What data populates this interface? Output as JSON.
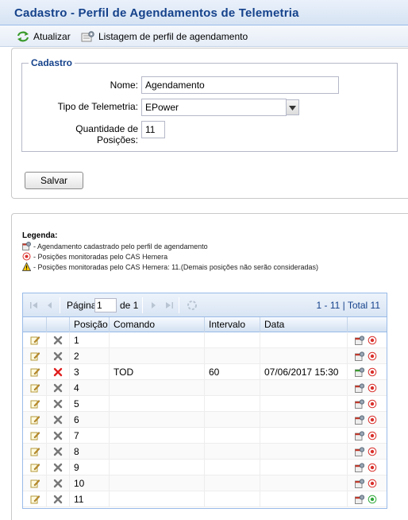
{
  "title": "Cadastro - Perfil de Agendamentos de Telemetria",
  "toolbar": {
    "refresh_label": "Atualizar",
    "list_label": "Listagem de perfil de agendamento"
  },
  "form": {
    "legend": "Cadastro",
    "name_label": "Nome:",
    "name_value": "Agendamento",
    "type_label": "Tipo de Telemetria:",
    "type_value": "EPower",
    "qty_label_line1": "Quantidade de",
    "qty_label_line2": "Posições:",
    "qty_value": "11",
    "save_label": "Salvar"
  },
  "legend": {
    "title": "Legenda:",
    "items": [
      "- Agendamento cadastrado pelo perfil de agendamento",
      "- Posições monitoradas pelo CAS Hemera",
      "- Posições monitoradas pelo CAS Hemera: 11.(Demais posições não serão consideradas)"
    ]
  },
  "pager": {
    "page_label": "Página",
    "page_value": "1",
    "of_label": "de 1",
    "info": "1 - 11 | Total 11"
  },
  "grid": {
    "columns": [
      "Posição",
      "Comando",
      "Intervalo",
      "Data"
    ],
    "rows": [
      {
        "pos": "1",
        "cmd": "",
        "interval": "",
        "date": "",
        "active": false
      },
      {
        "pos": "2",
        "cmd": "",
        "interval": "",
        "date": "",
        "active": false
      },
      {
        "pos": "3",
        "cmd": "TOD",
        "interval": "60",
        "date": "07/06/2017 15:30",
        "active": true
      },
      {
        "pos": "4",
        "cmd": "",
        "interval": "",
        "date": "",
        "active": false
      },
      {
        "pos": "5",
        "cmd": "",
        "interval": "",
        "date": "",
        "active": false
      },
      {
        "pos": "6",
        "cmd": "",
        "interval": "",
        "date": "",
        "active": false
      },
      {
        "pos": "7",
        "cmd": "",
        "interval": "",
        "date": "",
        "active": false
      },
      {
        "pos": "8",
        "cmd": "",
        "interval": "",
        "date": "",
        "active": false
      },
      {
        "pos": "9",
        "cmd": "",
        "interval": "",
        "date": "",
        "active": false
      },
      {
        "pos": "10",
        "cmd": "",
        "interval": "",
        "date": "",
        "active": false
      },
      {
        "pos": "11",
        "cmd": "",
        "interval": "",
        "date": "",
        "active": false
      }
    ]
  },
  "colors": {
    "title": "#15428b",
    "border": "#99bbe8",
    "delete_active": "#e02020",
    "delete_inactive": "#777777",
    "monitor_red": "#d9302c",
    "monitor_green": "#2fa83a"
  }
}
